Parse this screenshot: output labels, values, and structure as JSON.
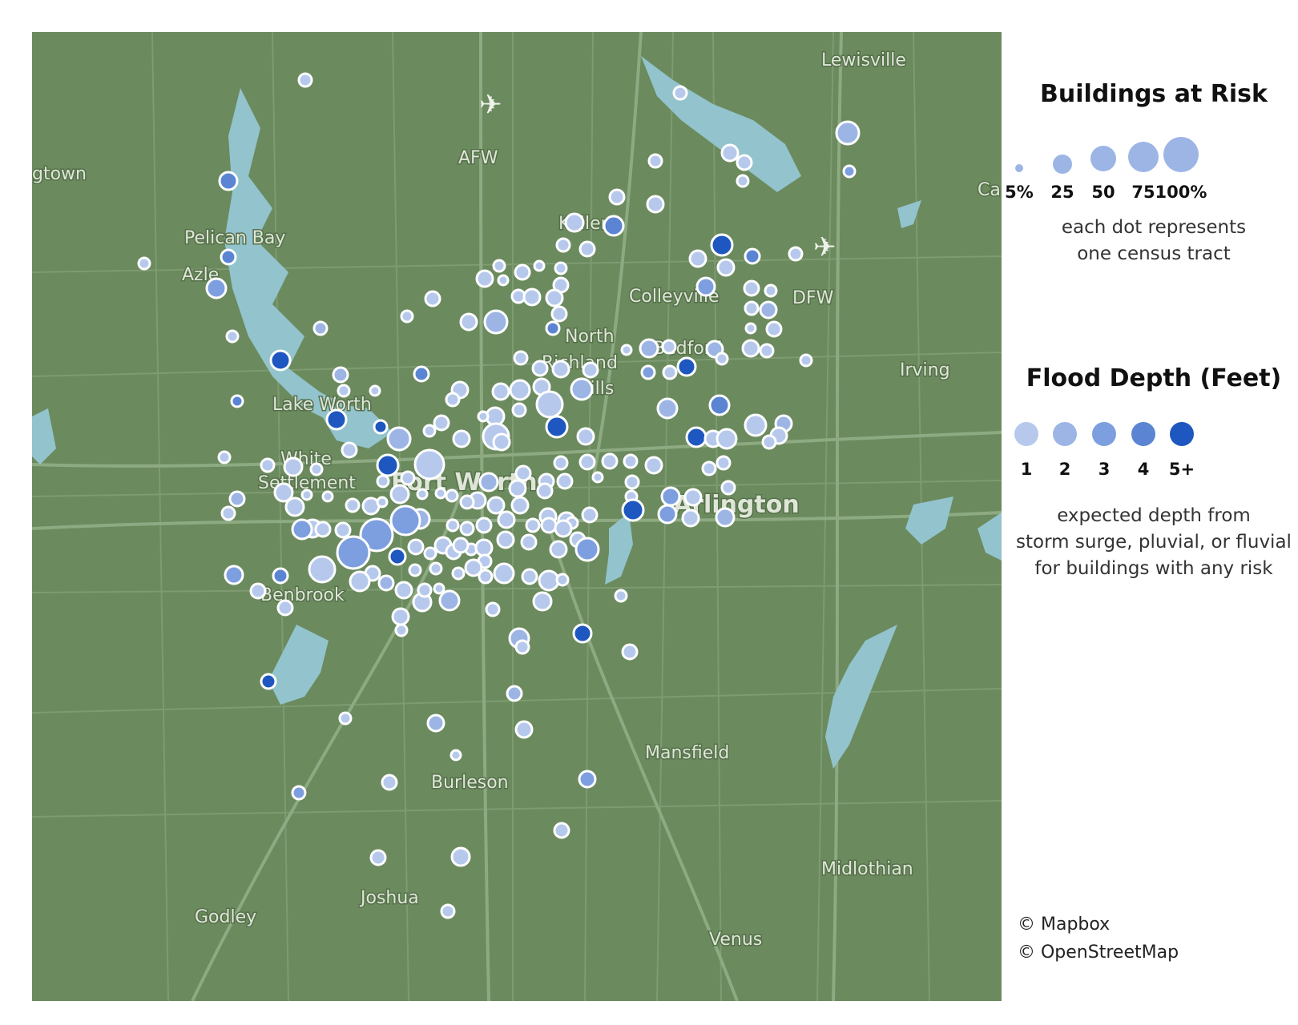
{
  "map": {
    "places": [
      "Lewisville",
      "gtown",
      "AFW",
      "Keller",
      "Pelican Bay",
      "Azle",
      "Colleyville",
      "DFW",
      "North",
      "Richland",
      "Hills",
      "Bedford",
      "Irving",
      "Lake Worth",
      "White",
      "Settlement",
      "Fort Worth",
      "Arlington",
      "Benbrook",
      "Mansfield",
      "Burleson",
      "Midlothian",
      "Joshua",
      "Godley",
      "Venus",
      "Ca"
    ],
    "airports": [
      "AFW",
      "DFW"
    ],
    "colors": {
      "land": "#6b8a5e",
      "water": "#93c3cc",
      "road": "#7e9b72",
      "major_road": "#8eaa82"
    }
  },
  "legend": {
    "size_title": "Buildings at Risk",
    "size_labels": [
      "5%",
      "25",
      "50",
      "75",
      "100%"
    ],
    "size_note_1": "each dot represents",
    "size_note_2": "one census tract",
    "depth_title": "Flood Depth (Feet)",
    "depth_labels": [
      "1",
      "2",
      "3",
      "4",
      "5+"
    ],
    "depth_colors": [
      "#b6c9ec",
      "#9cb5e5",
      "#7d9fdf",
      "#5b85d3",
      "#1e57bf"
    ],
    "depth_note_1": "expected depth from",
    "depth_note_2": "storm surge, pluvial, or fluvial",
    "depth_note_3": "for buildings with any risk"
  },
  "credits": {
    "mapbox": "© Mapbox",
    "osm": "© OpenStreetMap"
  }
}
